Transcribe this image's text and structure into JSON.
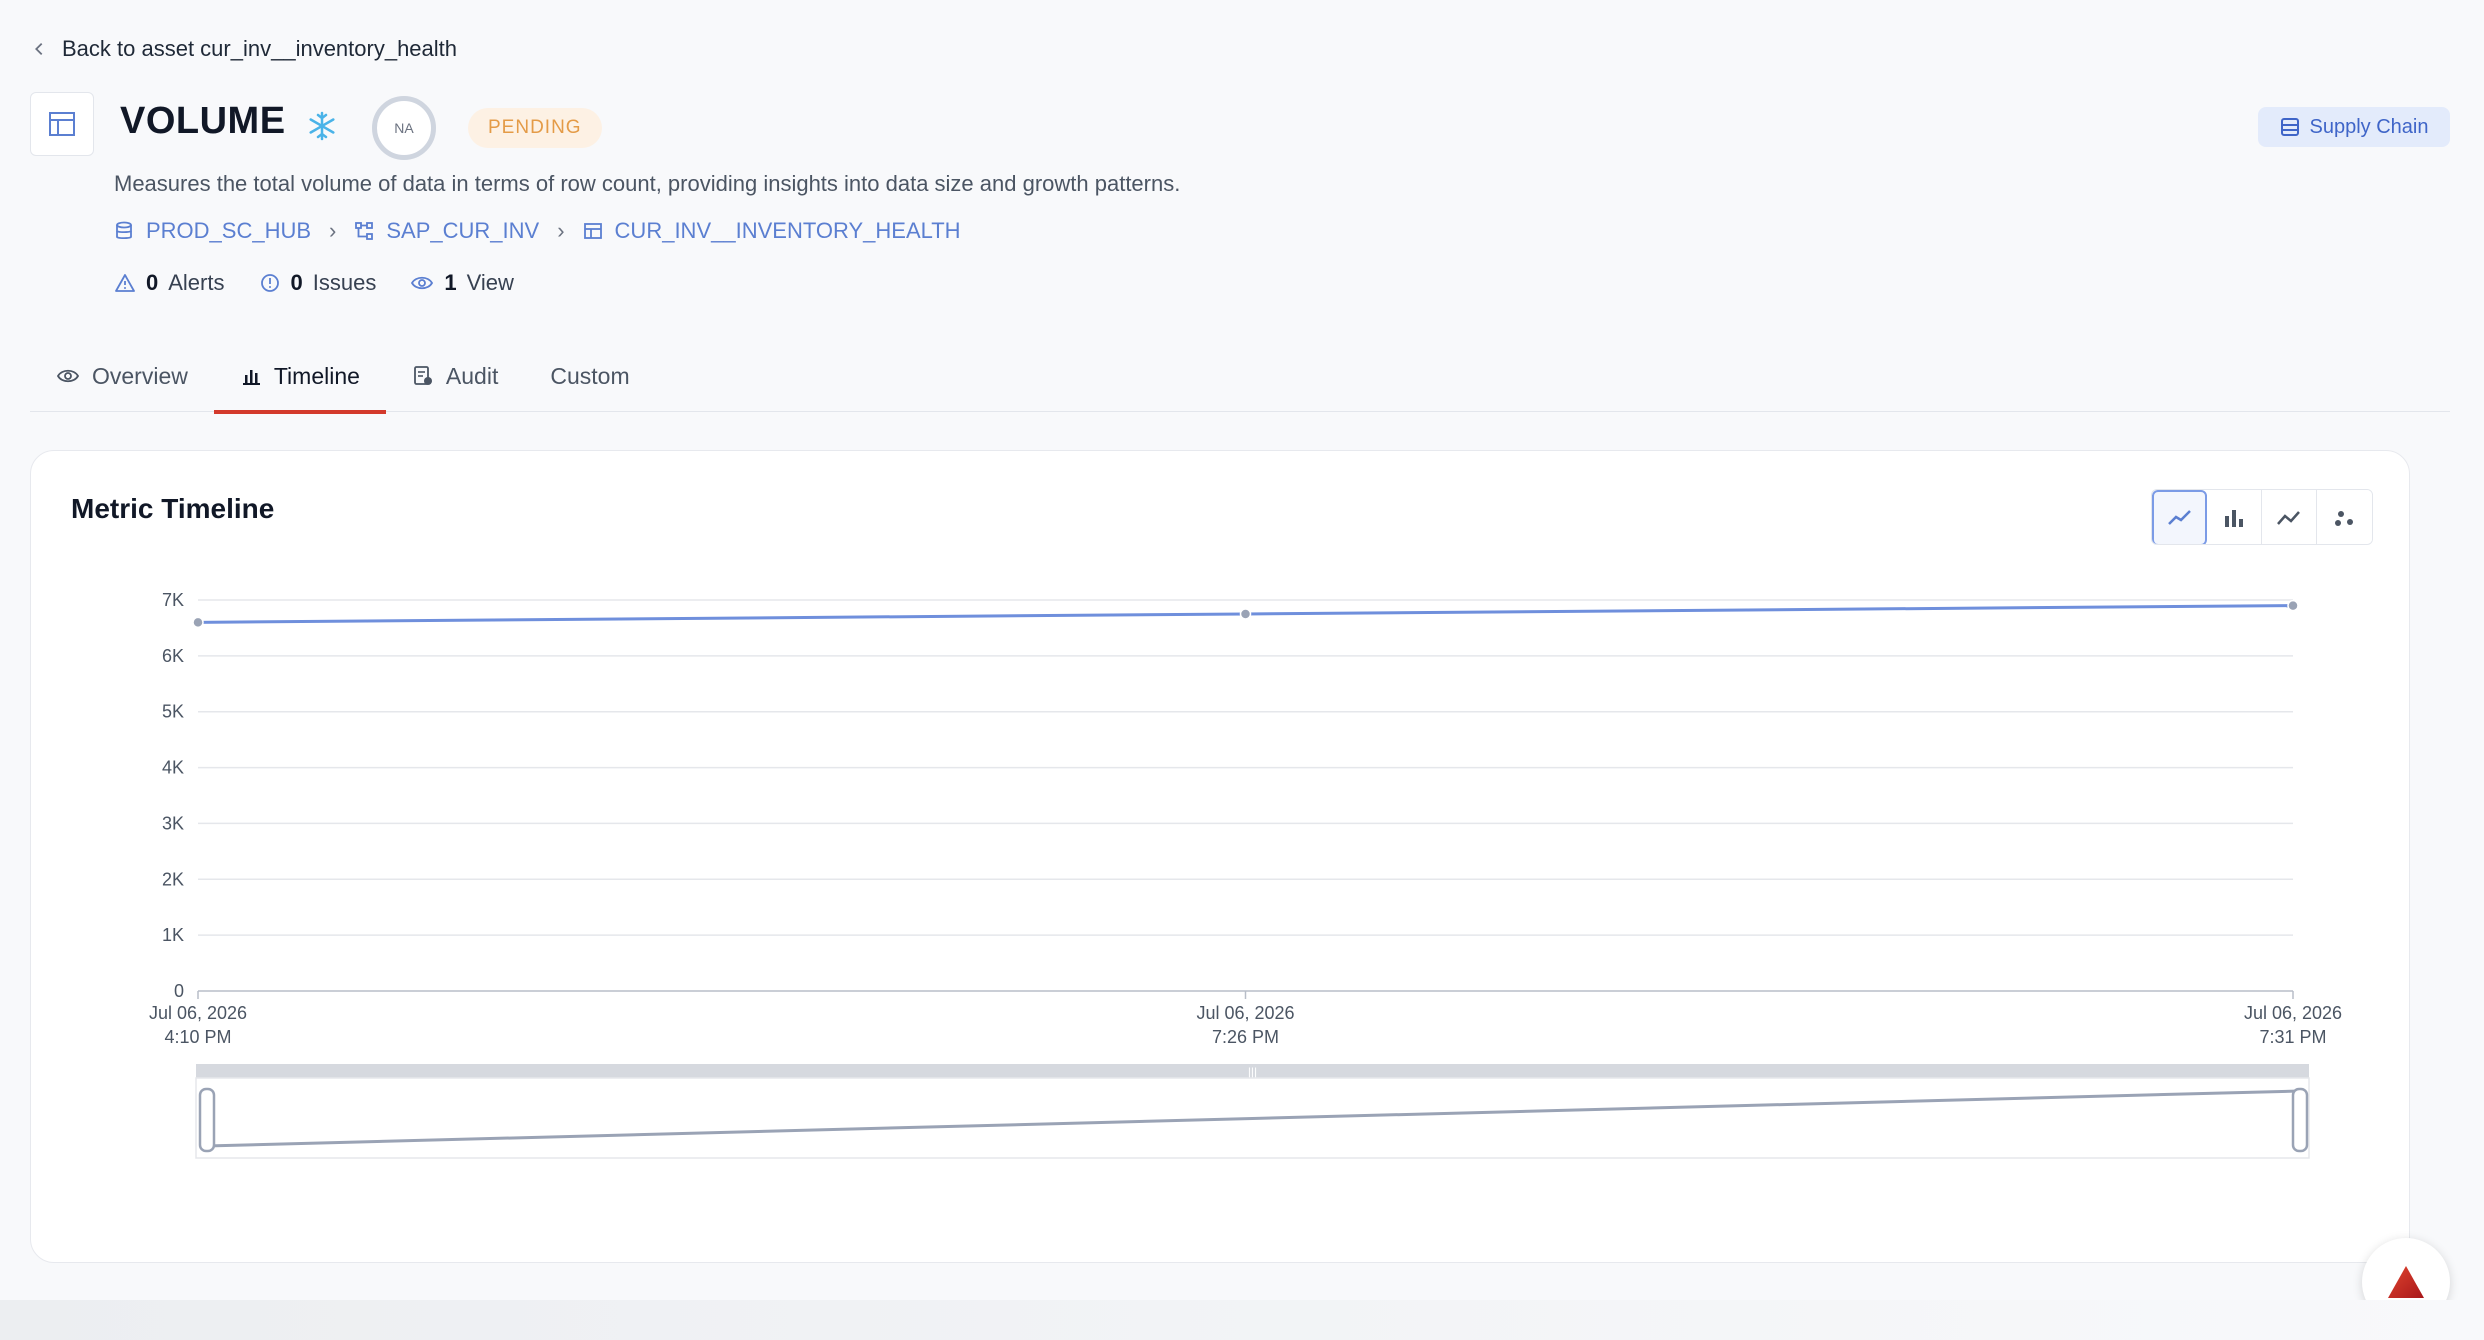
{
  "back": {
    "label": "Back to asset cur_inv__inventory_health"
  },
  "header": {
    "title": "VOLUME",
    "score": "NA",
    "status": "PENDING",
    "domain_button": "Supply Chain",
    "description": "Measures the total volume of data in terms of row count, providing insights into data size and growth patterns."
  },
  "breadcrumb": [
    {
      "label": "PROD_SC_HUB",
      "icon": "database-icon"
    },
    {
      "label": "SAP_CUR_INV",
      "icon": "schema-icon"
    },
    {
      "label": "CUR_INV__INVENTORY_HEALTH",
      "icon": "table-icon"
    }
  ],
  "stats": {
    "alerts": {
      "count": "0",
      "label": "Alerts"
    },
    "issues": {
      "count": "0",
      "label": "Issues"
    },
    "views": {
      "count": "1",
      "label": "View"
    }
  },
  "tabs": [
    {
      "label": "Overview",
      "icon": "eye-icon"
    },
    {
      "label": "Timeline",
      "icon": "bar-chart-icon",
      "active": true
    },
    {
      "label": "Audit",
      "icon": "audit-icon"
    },
    {
      "label": "Custom"
    }
  ],
  "card": {
    "title": "Metric Timeline"
  },
  "colors": {
    "accent": "#5b7fd1",
    "active_tab": "#d33a2c",
    "pending_bg": "#fdf1e4",
    "pending_text": "#e49b47",
    "line": "#6f8fdc"
  },
  "chart_data": {
    "type": "line",
    "title": "",
    "xlabel": "",
    "ylabel": "",
    "x": [
      [
        "Jul 06, 2026",
        "4:10 PM"
      ],
      [
        "Jul 06, 2026",
        "7:26 PM"
      ],
      [
        "Jul 06, 2026",
        "7:31 PM"
      ]
    ],
    "series": [
      {
        "values": [
          6600,
          6750,
          6900
        ]
      }
    ],
    "y_ticks": [
      "0",
      "1K",
      "2K",
      "3K",
      "4K",
      "5K",
      "6K",
      "7K"
    ],
    "ylim": [
      0,
      7000
    ],
    "grid": true,
    "has_range_slider": true
  }
}
